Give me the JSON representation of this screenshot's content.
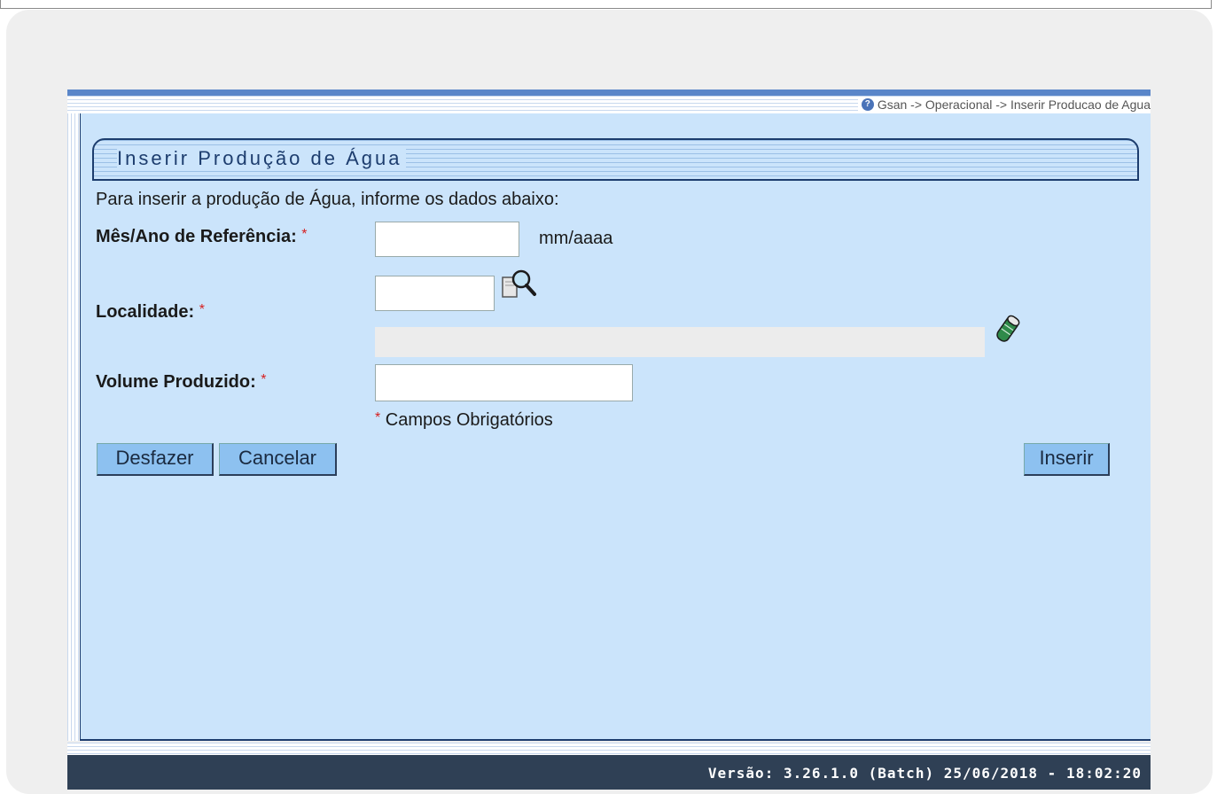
{
  "breadcrumb": "Gsan -> Operacional -> Inserir Producao de Agua",
  "icons": {
    "help": "help-icon",
    "search": "search-magnifier-icon",
    "clear": "eraser-icon"
  },
  "form": {
    "title": "Inserir Produção de Água",
    "instructions": "Para inserir a produção de Água, informe os dados abaixo:",
    "fields": {
      "mes_ano": {
        "label": "Mês/Ano de Referência:",
        "required_mark": "*",
        "value": "",
        "hint": "mm/aaaa"
      },
      "localidade": {
        "label": "Localidade:",
        "required_mark": "*",
        "code_value": "",
        "description_value": ""
      },
      "volume": {
        "label": "Volume Produzido:",
        "required_mark": "*",
        "value": ""
      }
    },
    "required_note_mark": "*",
    "required_note": "Campos Obrigatórios"
  },
  "buttons": {
    "undo": "Desfazer",
    "cancel": "Cancelar",
    "insert": "Inserir"
  },
  "footer": {
    "version": "Versão: 3.26.1.0 (Batch) 25/06/2018 - 18:02:20"
  },
  "colors": {
    "panel": "#cbe4fb",
    "button": "#8dc1f0",
    "footer": "#2f4055",
    "required": "#d62020",
    "title": "#1d3d6e"
  }
}
